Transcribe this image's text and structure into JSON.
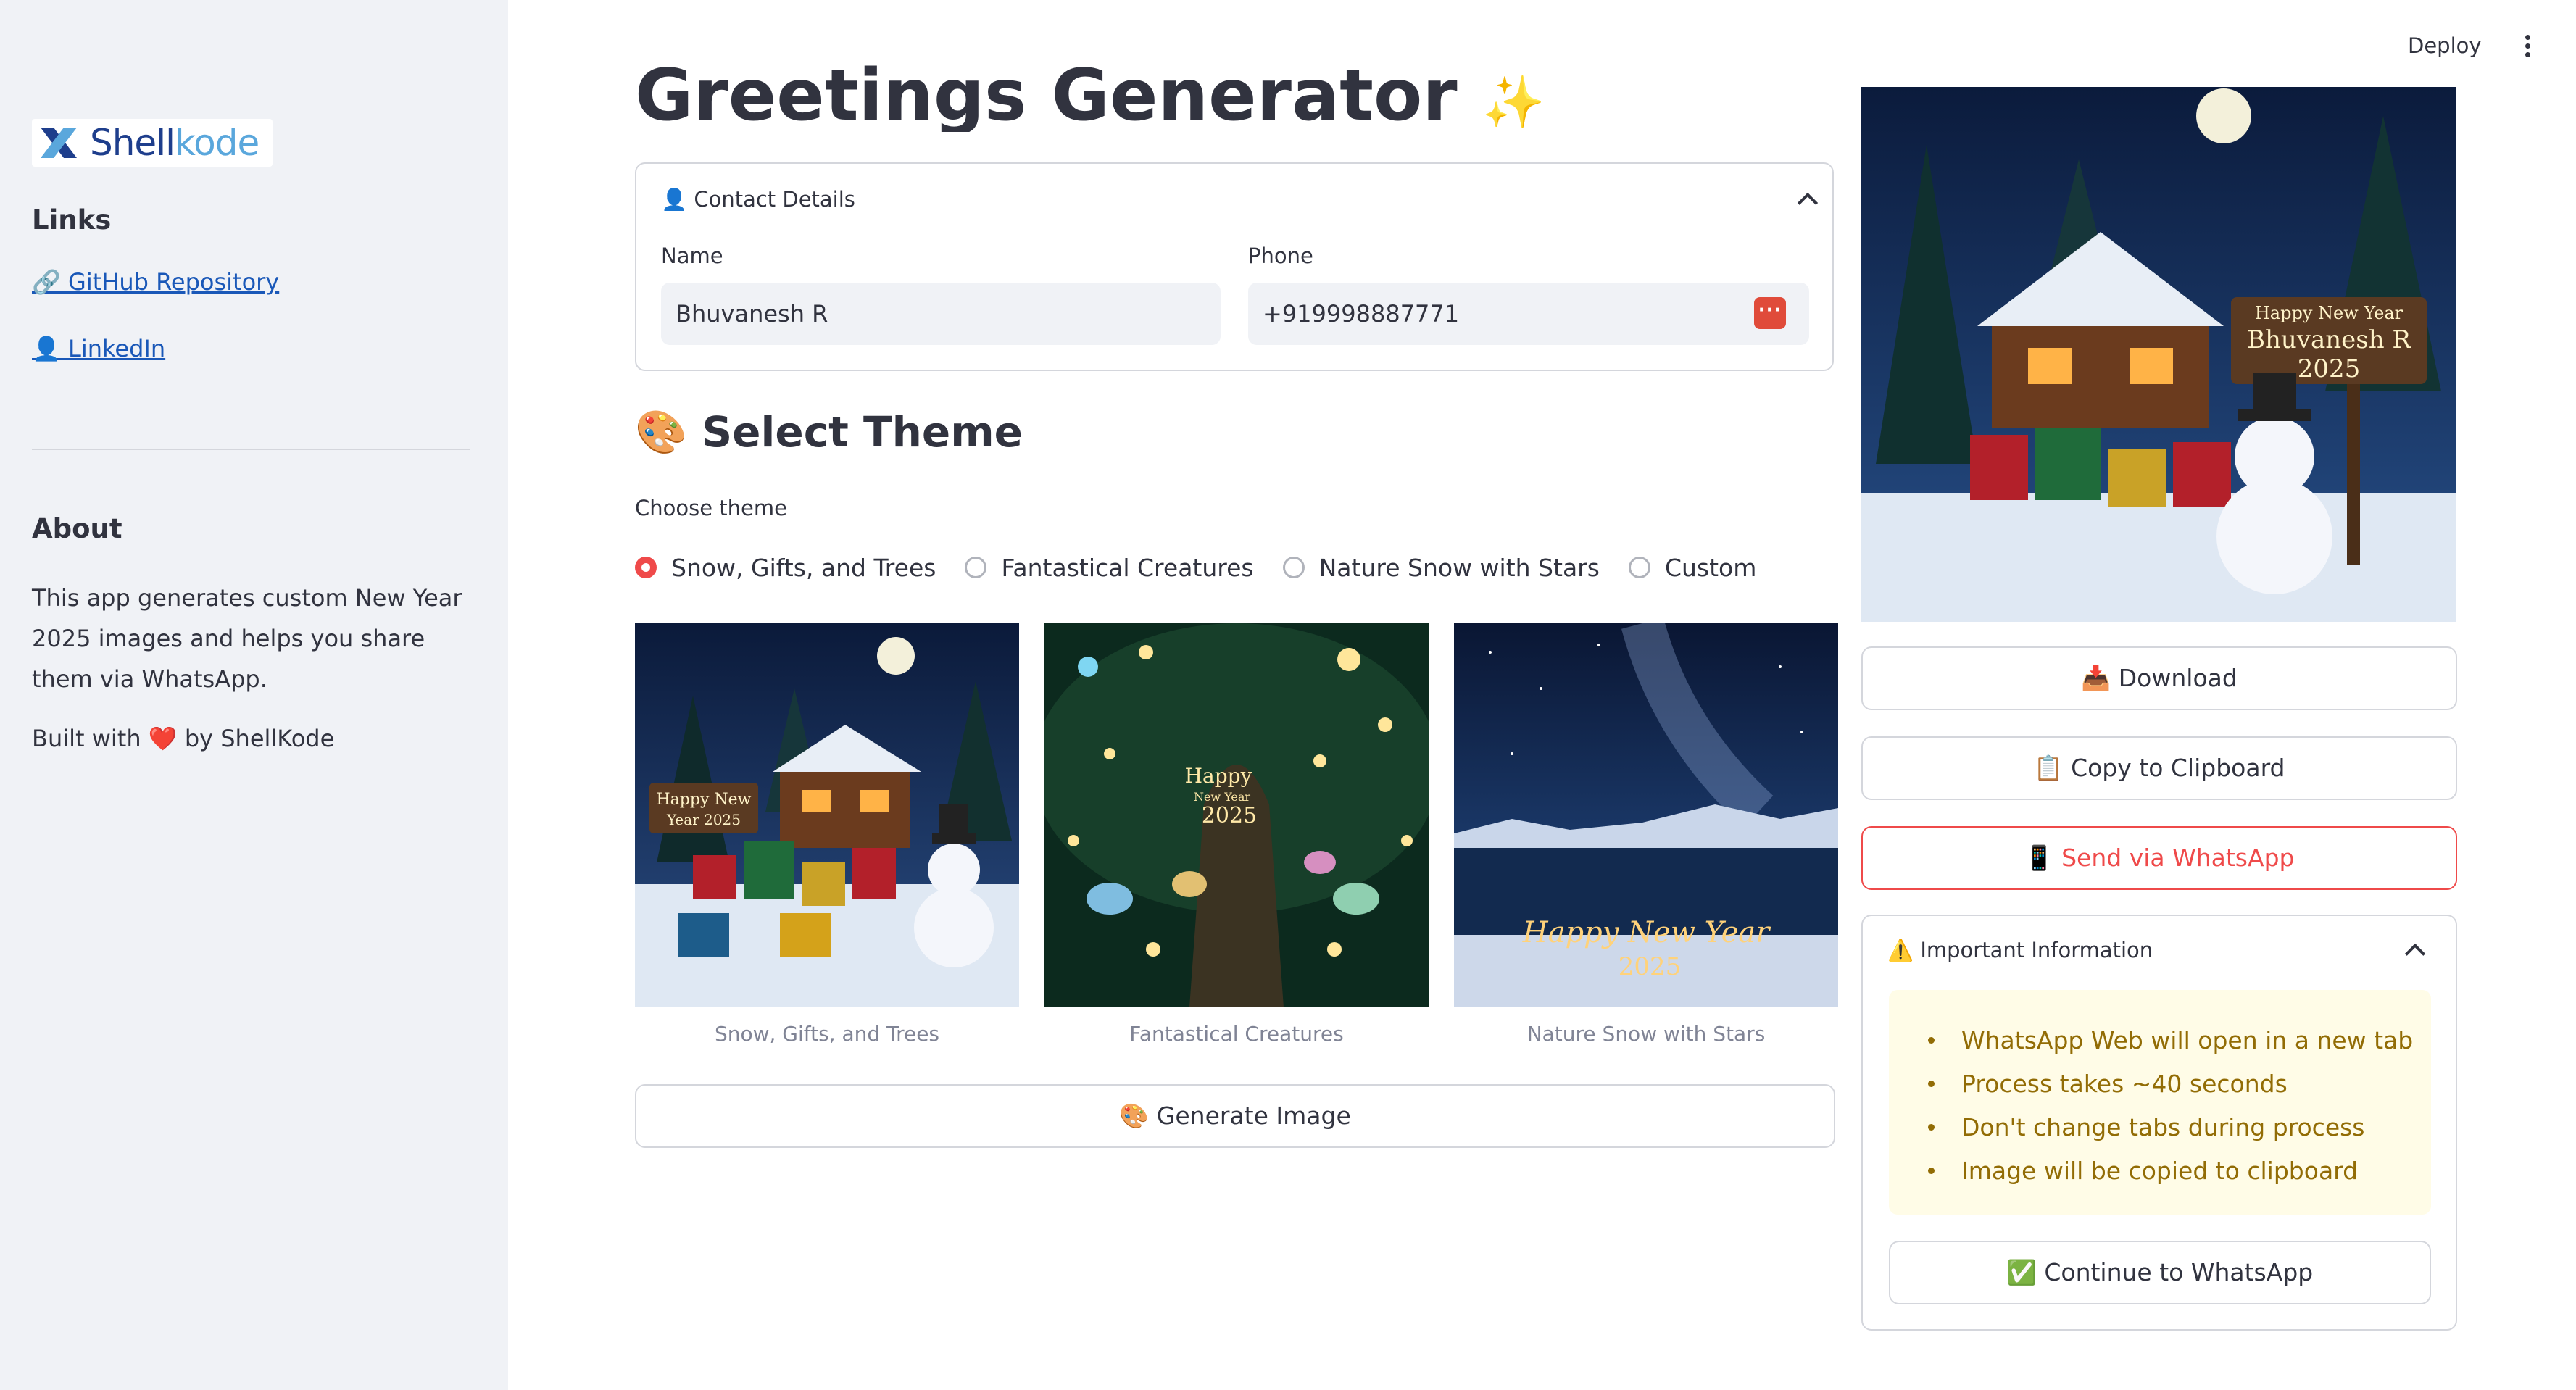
{
  "sidebar": {
    "logo_text_a": "Shell",
    "logo_text_b": "kode",
    "links_heading": "Links",
    "github_link": "🔗 GitHub Repository",
    "linkedin_link": "👤 LinkedIn",
    "about_heading": "About",
    "about_text": "This app generates custom New Year 2025 images and helps you share them via WhatsApp.",
    "built_with": "Built with ❤️ by ShellKode"
  },
  "topbar": {
    "deploy_label": "Deploy"
  },
  "main": {
    "title": "Greetings Generator",
    "title_emoji": "✨",
    "contact": {
      "label": "👤 Contact Details",
      "name_label": "Name",
      "name_value": "Bhuvanesh R",
      "phone_label": "Phone",
      "phone_value": "+919998887771"
    },
    "theme_heading": "🎨 Select Theme",
    "choose_label": "Choose theme",
    "themes": [
      {
        "label": "Snow, Gifts, and Trees",
        "selected": true
      },
      {
        "label": "Fantastical Creatures",
        "selected": false
      },
      {
        "label": "Nature Snow with Stars",
        "selected": false
      },
      {
        "label": "Custom",
        "selected": false
      }
    ],
    "thumbnails": [
      {
        "caption": "Snow, Gifts, and Trees",
        "text_a": "Happy New",
        "text_b": "Year 2025"
      },
      {
        "caption": "Fantastical Creatures",
        "text_a": "Happy",
        "text_b": "New Year",
        "text_c": "2025"
      },
      {
        "caption": "Nature Snow with Stars",
        "text_a": "Happy New Year",
        "text_b": "2025"
      }
    ],
    "generate_label": "🎨 Generate Image"
  },
  "right": {
    "preview": {
      "sign_a": "Happy New Year",
      "sign_b": "Bhuvanesh R",
      "sign_c": "2025"
    },
    "download_label": "📥 Download",
    "copy_label": "📋 Copy to Clipboard",
    "whatsapp_label": "📱 Send via WhatsApp",
    "info": {
      "label": "⚠️ Important Information",
      "items": [
        "WhatsApp Web will open in a new tab",
        "Process takes ~40 seconds",
        "Don't change tabs during process",
        "Image will be copied to clipboard"
      ],
      "continue_label": "✅ Continue to WhatsApp"
    }
  }
}
